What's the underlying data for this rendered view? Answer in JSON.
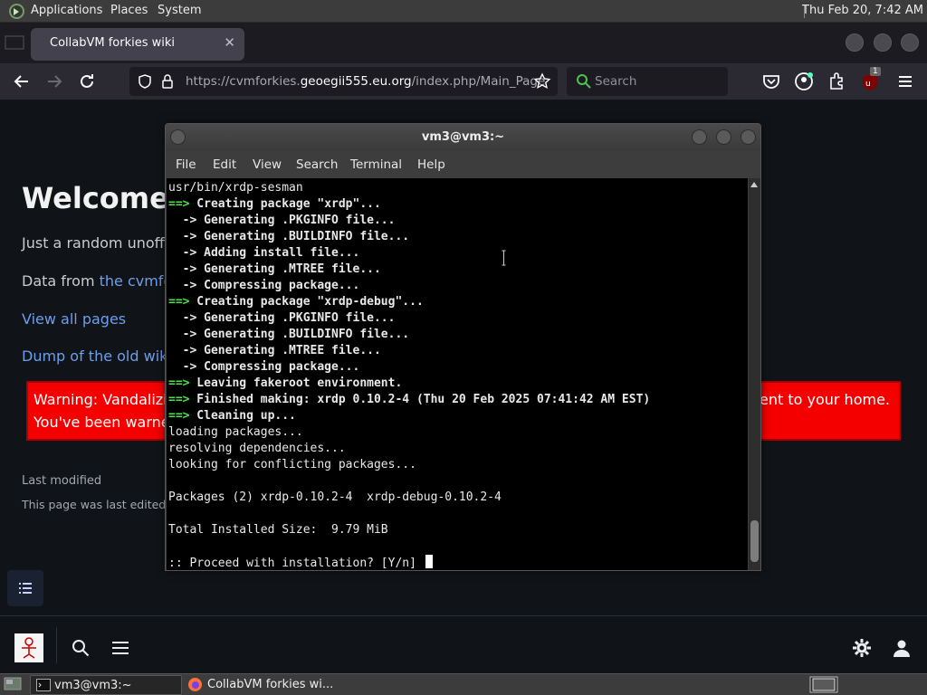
{
  "top_panel": {
    "menus": [
      "Applications",
      "Places",
      "System"
    ],
    "clock": "Thu Feb 20,  7:42 AM"
  },
  "browser": {
    "tab_title": "CollabVM forkies wiki",
    "url_prefix": "https://cvmforkies.",
    "url_domain": "geoegii555.eu.org",
    "url_suffix": "/index.php/Main_Page",
    "search_placeholder": "Search",
    "ublock_badge": "1"
  },
  "wiki": {
    "title": "Welcome to",
    "intro": "Just a random unoffici",
    "data_from_prefix": "Data from ",
    "data_from_link": "the cvmforki",
    "view_all_link": "View all pages",
    "dump_link": "Dump of the old wiki",
    "warning_line1": "Warning: Vandalizing",
    "warning_line2": "You've been warned.",
    "warning_right": "g sent to your home.",
    "last_modified_title": "Last modified",
    "last_modified_text": "This page was last edited o"
  },
  "terminal": {
    "title": "vm3@vm3:~",
    "menus": [
      "File",
      "Edit",
      "View",
      "Search",
      "Terminal",
      "Help"
    ],
    "lines": [
      {
        "arrow": "",
        "text": "usr/bin/xrdp-sesman",
        "bold": false
      },
      {
        "arrow": "==>",
        "text": " Creating package \"xrdp\"...",
        "bold": true
      },
      {
        "arrow": "",
        "text": "  -> Generating .PKGINFO file...",
        "bold": true
      },
      {
        "arrow": "",
        "text": "  -> Generating .BUILDINFO file...",
        "bold": true
      },
      {
        "arrow": "",
        "text": "  -> Adding install file...",
        "bold": true
      },
      {
        "arrow": "",
        "text": "  -> Generating .MTREE file...",
        "bold": true
      },
      {
        "arrow": "",
        "text": "  -> Compressing package...",
        "bold": true
      },
      {
        "arrow": "==>",
        "text": " Creating package \"xrdp-debug\"...",
        "bold": true
      },
      {
        "arrow": "",
        "text": "  -> Generating .PKGINFO file...",
        "bold": true
      },
      {
        "arrow": "",
        "text": "  -> Generating .BUILDINFO file...",
        "bold": true
      },
      {
        "arrow": "",
        "text": "  -> Generating .MTREE file...",
        "bold": true
      },
      {
        "arrow": "",
        "text": "  -> Compressing package...",
        "bold": true
      },
      {
        "arrow": "==>",
        "text": " Leaving fakeroot environment.",
        "bold": true
      },
      {
        "arrow": "==>",
        "text": " Finished making: xrdp 0.10.2-4 (Thu 20 Feb 2025 07:41:42 AM EST)",
        "bold": true
      },
      {
        "arrow": "==>",
        "text": " Cleaning up...",
        "bold": true
      },
      {
        "arrow": "",
        "text": "loading packages...",
        "bold": false
      },
      {
        "arrow": "",
        "text": "resolving dependencies...",
        "bold": false
      },
      {
        "arrow": "",
        "text": "looking for conflicting packages...",
        "bold": false
      },
      {
        "arrow": "",
        "text": "",
        "bold": false
      },
      {
        "arrow": "",
        "text": "Packages (2) xrdp-0.10.2-4  xrdp-debug-0.10.2-4",
        "bold": false
      },
      {
        "arrow": "",
        "text": "",
        "bold": false
      },
      {
        "arrow": "",
        "text": "Total Installed Size:  9.79 MiB",
        "bold": false
      },
      {
        "arrow": "",
        "text": "",
        "bold": false
      },
      {
        "arrow": "",
        "text": ":: Proceed with installation? [Y/n] ",
        "bold": false,
        "cursor": true
      }
    ]
  },
  "taskbar": {
    "terminal_task": "vm3@vm3:~",
    "firefox_task": "CollabVM forkies wi..."
  }
}
